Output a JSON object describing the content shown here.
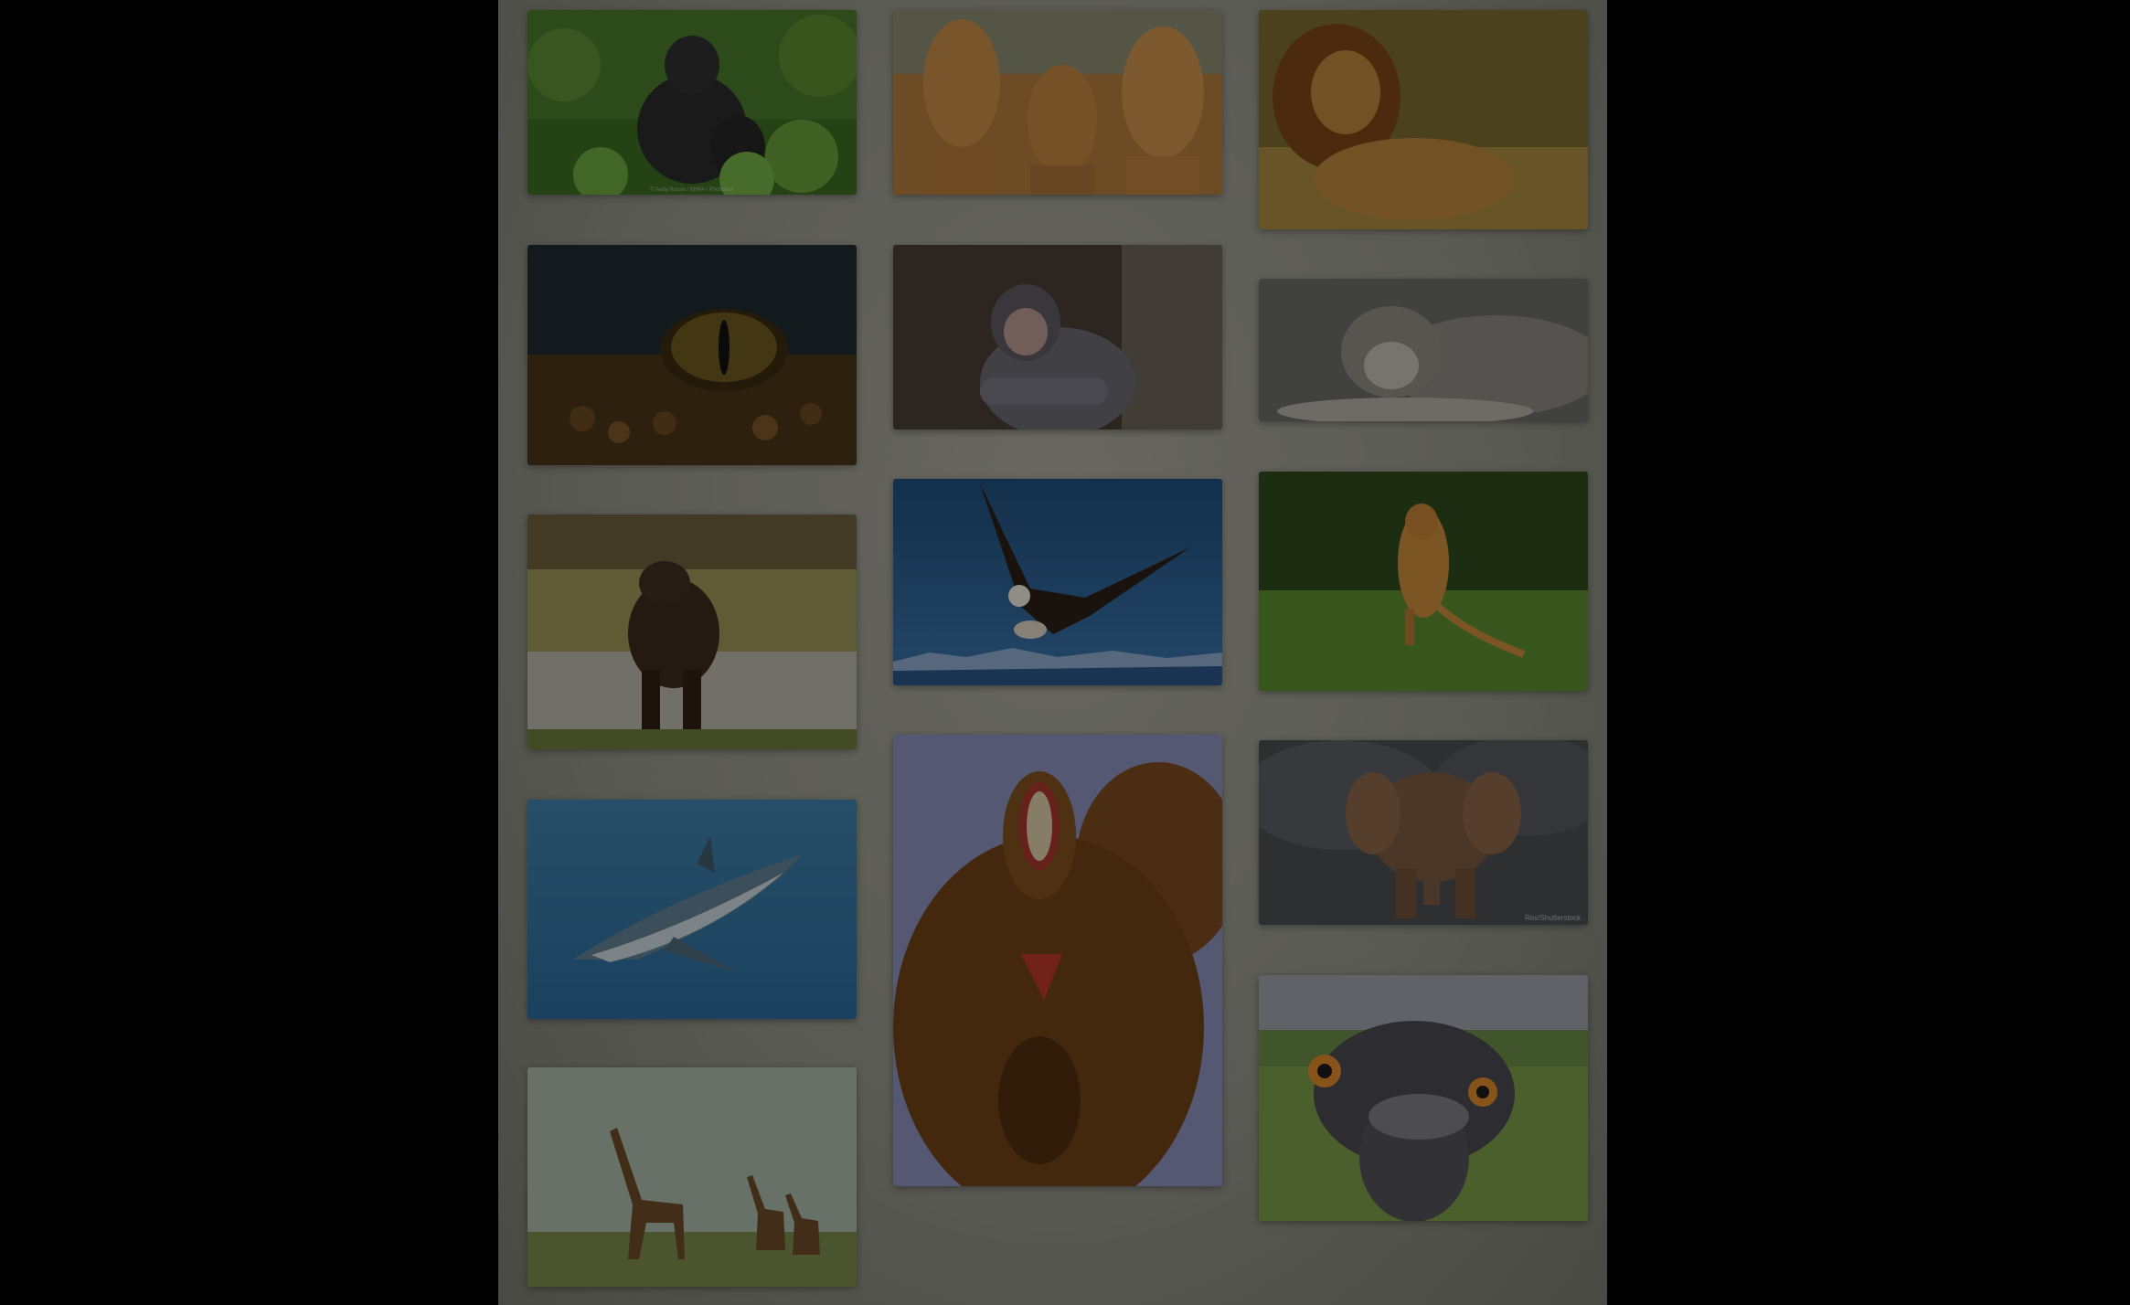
{
  "gallery": {
    "images": [
      {
        "name": "gorilla",
        "watermark": "© Andy Rouse / NHPA / Photoshot"
      },
      {
        "name": "camels"
      },
      {
        "name": "lion"
      },
      {
        "name": "crocodile-eye"
      },
      {
        "name": "chimpanzee"
      },
      {
        "name": "wolf"
      },
      {
        "name": "brown-bear"
      },
      {
        "name": "bald-eagle"
      },
      {
        "name": "cheetah"
      },
      {
        "name": "shark"
      },
      {
        "name": "gelada-baboon"
      },
      {
        "name": "elephant",
        "watermark": "Rex/Shutterstock"
      },
      {
        "name": "giraffes"
      },
      {
        "name": "ostrich"
      }
    ]
  },
  "overlay": {
    "color": "#000000",
    "opacity": 0.38
  }
}
